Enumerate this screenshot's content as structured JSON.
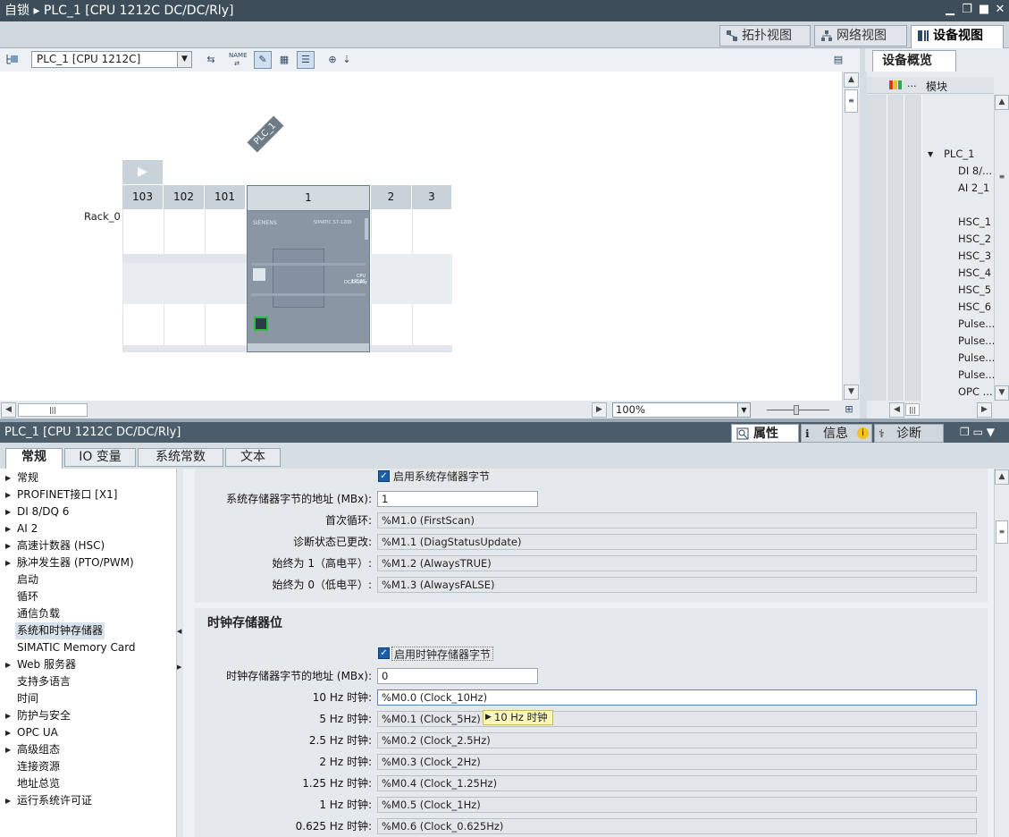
{
  "window": {
    "title": "自锁 ▸ PLC_1 [CPU 1212C DC/DC/Rly]"
  },
  "view_tabs": {
    "topology": "拓扑视图",
    "network": "网络视图",
    "device": "设备视图"
  },
  "device_toolbar": {
    "selected_device": "PLC_1 [CPU 1212C]"
  },
  "rack": {
    "plc_tag": "PLC_1",
    "rack_name": "Rack_0",
    "slots": [
      "103",
      "102",
      "101",
      "1",
      "2",
      "3"
    ],
    "cpu_brand": "SIEMENS",
    "cpu_series": "SIMATIC S7-1200",
    "cpu_type": "CPU 1212C",
    "cpu_variant": "DC/DC/Rly"
  },
  "zoom": {
    "value": "100%"
  },
  "overview": {
    "tab": "设备概览",
    "col_dots": "...",
    "col_module": "模块",
    "rows": [
      {
        "label": "",
        "indent": 0,
        "expand": false
      },
      {
        "label": "",
        "indent": 0,
        "expand": false
      },
      {
        "label": "",
        "indent": 0,
        "expand": false
      },
      {
        "label": "PLC_1",
        "indent": 1,
        "expand": true
      },
      {
        "label": "DI 8/...",
        "indent": 2,
        "expand": false
      },
      {
        "label": "AI 2_1",
        "indent": 2,
        "expand": false
      },
      {
        "label": "",
        "indent": 0,
        "expand": false
      },
      {
        "label": "HSC_1",
        "indent": 2,
        "expand": false
      },
      {
        "label": "HSC_2",
        "indent": 2,
        "expand": false
      },
      {
        "label": "HSC_3",
        "indent": 2,
        "expand": false
      },
      {
        "label": "HSC_4",
        "indent": 2,
        "expand": false
      },
      {
        "label": "HSC_5",
        "indent": 2,
        "expand": false
      },
      {
        "label": "HSC_6",
        "indent": 2,
        "expand": false
      },
      {
        "label": "Pulse...",
        "indent": 2,
        "expand": false
      },
      {
        "label": "Pulse...",
        "indent": 2,
        "expand": false
      },
      {
        "label": "Pulse...",
        "indent": 2,
        "expand": false
      },
      {
        "label": "Pulse...",
        "indent": 2,
        "expand": false
      },
      {
        "label": "OPC ...",
        "indent": 2,
        "expand": false
      }
    ]
  },
  "properties": {
    "title": "PLC_1 [CPU 1212C DC/DC/Rly]",
    "tab_properties": "属性",
    "tab_info": "信息",
    "tab_diagnostics": "诊断",
    "sub_tabs": [
      "常规",
      "IO 变量",
      "系统常数",
      "文本"
    ]
  },
  "nav": {
    "items": [
      {
        "label": "常规",
        "arrow": true
      },
      {
        "label": "PROFINET接口 [X1]",
        "arrow": true
      },
      {
        "label": "DI 8/DQ 6",
        "arrow": true
      },
      {
        "label": "AI 2",
        "arrow": true
      },
      {
        "label": "高速计数器 (HSC)",
        "arrow": true
      },
      {
        "label": "脉冲发生器 (PTO/PWM)",
        "arrow": true
      },
      {
        "label": "启动",
        "arrow": false
      },
      {
        "label": "循环",
        "arrow": false
      },
      {
        "label": "通信负载",
        "arrow": false
      },
      {
        "label": "系统和时钟存储器",
        "arrow": false,
        "selected": true
      },
      {
        "label": "SIMATIC Memory Card",
        "arrow": false
      },
      {
        "label": "Web 服务器",
        "arrow": true
      },
      {
        "label": "支持多语言",
        "arrow": false
      },
      {
        "label": "时间",
        "arrow": false
      },
      {
        "label": "防护与安全",
        "arrow": true
      },
      {
        "label": "OPC UA",
        "arrow": true
      },
      {
        "label": "高级组态",
        "arrow": true
      },
      {
        "label": "连接资源",
        "arrow": false
      },
      {
        "label": "地址总览",
        "arrow": false
      },
      {
        "label": "运行系统许可证",
        "arrow": true
      }
    ]
  },
  "system_memory": {
    "enable_label": "启用系统存储器字节",
    "enabled": true,
    "address_label": "系统存储器字节的地址 (MBx):",
    "address_value": "1",
    "fields": [
      {
        "label": "首次循环:",
        "value": "%M1.0 (FirstScan)"
      },
      {
        "label": "诊断状态已更改:",
        "value": "%M1.1 (DiagStatusUpdate)"
      },
      {
        "label": "始终为 1（高电平）:",
        "value": "%M1.2 (AlwaysTRUE)"
      },
      {
        "label": "始终为 0（低电平）:",
        "value": "%M1.3 (AlwaysFALSE)"
      }
    ]
  },
  "clock_memory": {
    "heading": "时钟存储器位",
    "enable_label": "启用时钟存储器字节",
    "enabled": true,
    "address_label": "时钟存储器字节的地址 (MBx):",
    "address_value": "0",
    "tooltip": "10 Hz 时钟",
    "fields": [
      {
        "label": "10 Hz 时钟:",
        "value": "%M0.0 (Clock_10Hz)"
      },
      {
        "label": "5 Hz 时钟:",
        "value": "%M0.1 (Clock_5Hz)"
      },
      {
        "label": "2.5 Hz 时钟:",
        "value": "%M0.2 (Clock_2.5Hz)"
      },
      {
        "label": "2 Hz 时钟:",
        "value": "%M0.3 (Clock_2Hz)"
      },
      {
        "label": "1.25 Hz 时钟:",
        "value": "%M0.4 (Clock_1.25Hz)"
      },
      {
        "label": "1 Hz 时钟:",
        "value": "%M0.5 (Clock_1Hz)"
      },
      {
        "label": "0.625 Hz 时钟:",
        "value": "%M0.6 (Clock_0.625Hz)"
      }
    ]
  }
}
